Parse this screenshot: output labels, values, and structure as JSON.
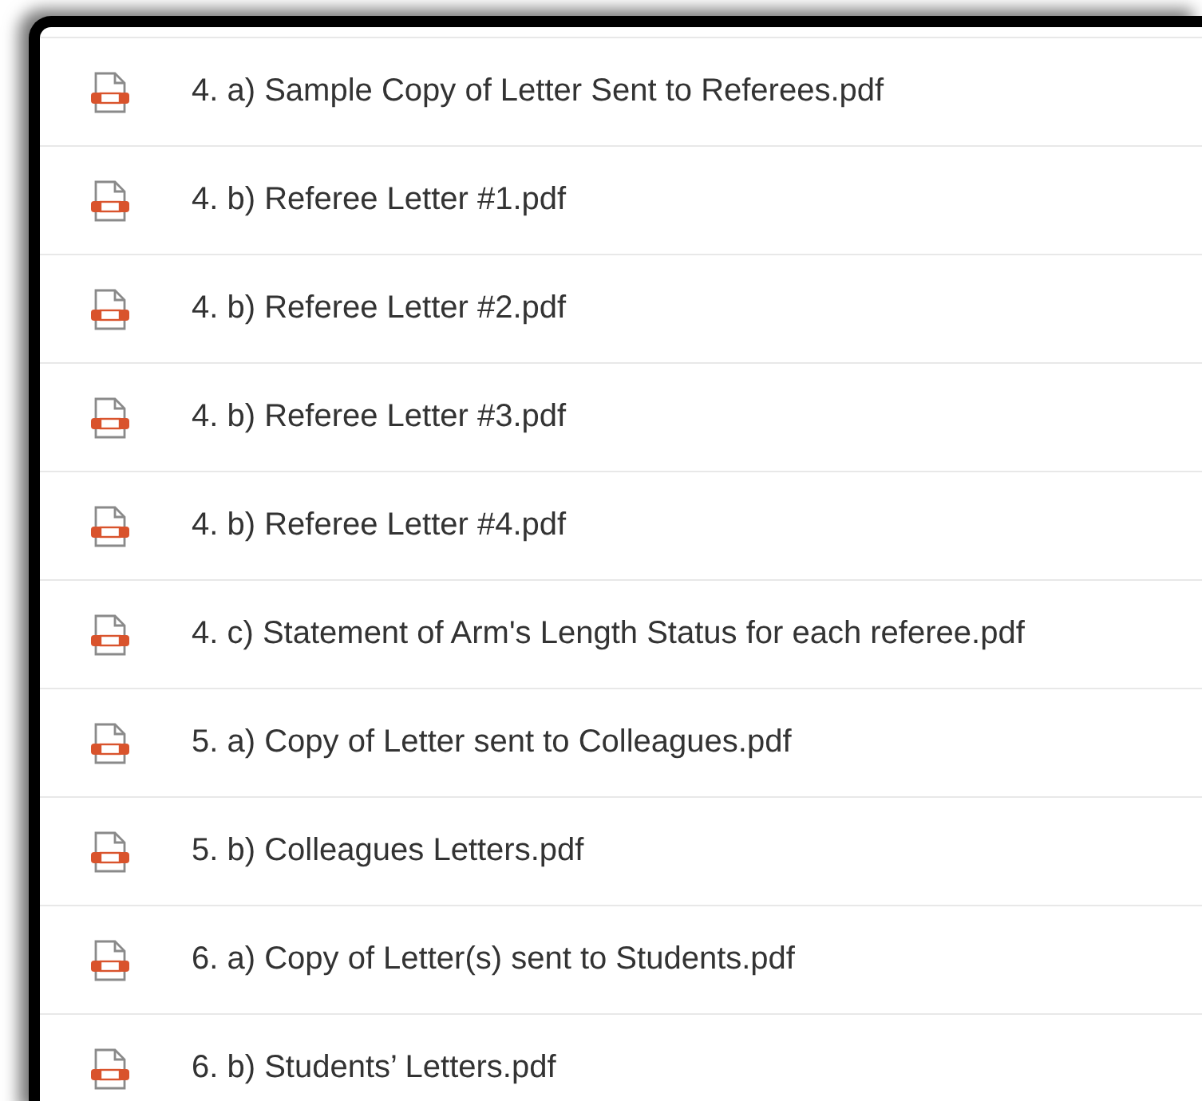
{
  "files": [
    {
      "name": "4. a) Sample Copy of Letter Sent to Referees.pdf"
    },
    {
      "name": "4. b) Referee Letter #1.pdf"
    },
    {
      "name": "4. b) Referee Letter #2.pdf"
    },
    {
      "name": "4. b) Referee Letter #3.pdf"
    },
    {
      "name": "4. b) Referee Letter #4.pdf"
    },
    {
      "name": "4. c) Statement of Arm's Length Status for each referee.pdf"
    },
    {
      "name": "5. a) Copy of Letter sent to Colleagues.pdf"
    },
    {
      "name": "5. b) Colleagues Letters.pdf"
    },
    {
      "name": "6. a) Copy of Letter(s) sent to Students.pdf"
    },
    {
      "name": "6. b) Students’ Letters.pdf"
    }
  ]
}
